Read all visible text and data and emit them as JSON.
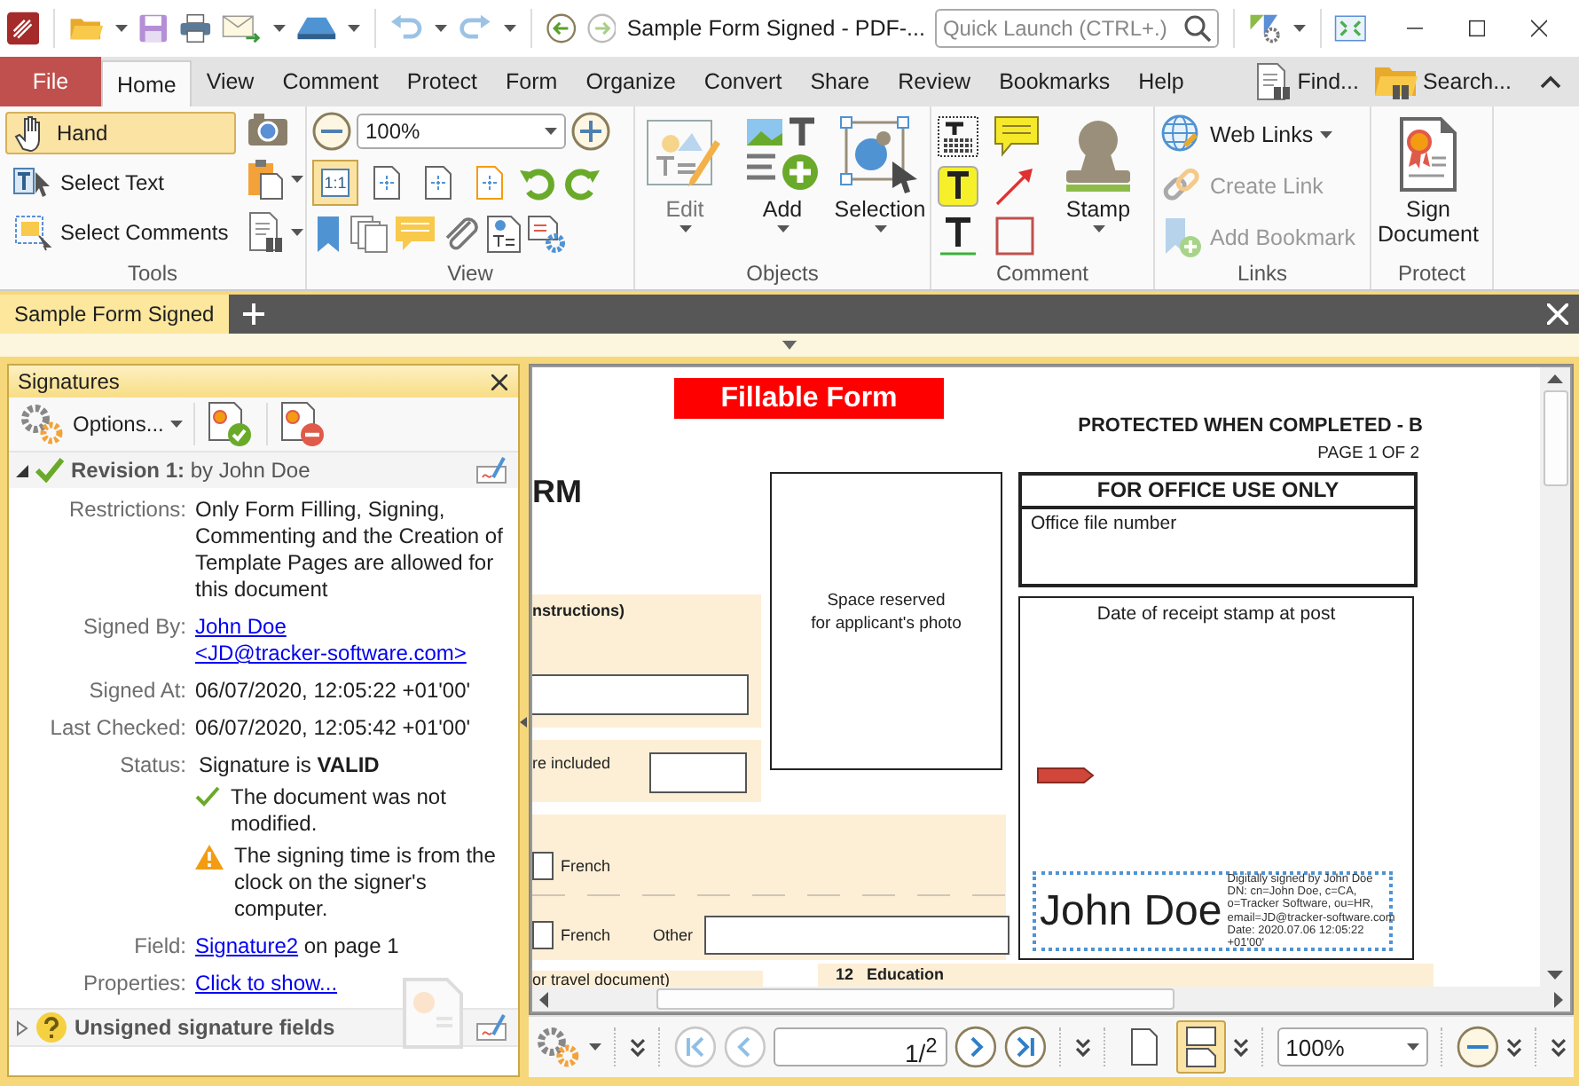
{
  "window": {
    "title": "Sample Form Signed - PDF-..."
  },
  "quick_launch": {
    "placeholder": "Quick Launch (CTRL+.)"
  },
  "ribbon": {
    "tabs": [
      {
        "label": "File",
        "kind": "file"
      },
      {
        "label": "Home",
        "kind": "tab",
        "selected": true
      },
      {
        "label": "View",
        "kind": "tab",
        "selected": false
      },
      {
        "label": "Comment",
        "kind": "tab",
        "selected": false
      },
      {
        "label": "Protect",
        "kind": "tab",
        "selected": false
      },
      {
        "label": "Form",
        "kind": "tab",
        "selected": false
      },
      {
        "label": "Organize",
        "kind": "tab",
        "selected": false
      },
      {
        "label": "Convert",
        "kind": "tab",
        "selected": false
      },
      {
        "label": "Share",
        "kind": "tab",
        "selected": false
      },
      {
        "label": "Review",
        "kind": "tab",
        "selected": false
      },
      {
        "label": "Bookmarks",
        "kind": "tab",
        "selected": false
      },
      {
        "label": "Help",
        "kind": "tab",
        "selected": false
      }
    ],
    "actions": [
      {
        "label": "Find..."
      },
      {
        "label": "Search..."
      }
    ],
    "groups": [
      {
        "kind": "tools",
        "title": "Tools",
        "items": [
          {
            "label": "Hand",
            "selected": true
          },
          {
            "label": "Select Text",
            "selected": false
          },
          {
            "label": "Select Comments",
            "selected": false
          }
        ]
      },
      {
        "kind": "view",
        "title": "View",
        "zoom": "100%",
        "fit_buttons": [
          {
            "label": "1:1",
            "selected": true
          },
          {
            "selected": false
          },
          {
            "selected": false
          },
          {
            "selected": false
          }
        ]
      },
      {
        "kind": "objects",
        "title": "Objects",
        "items": [
          {
            "label": "Edit",
            "disabled": true
          },
          {
            "label": "Add",
            "disabled": false
          },
          {
            "label": "Selection",
            "disabled": false
          }
        ]
      },
      {
        "kind": "comment",
        "title": "Comment",
        "items": [
          {
            "label": "Stamp"
          }
        ]
      },
      {
        "kind": "links",
        "title": "Links",
        "items": [
          {
            "label": "Web Links",
            "disabled": false
          },
          {
            "label": "Create Link",
            "disabled": true
          },
          {
            "label": "Add Bookmark",
            "disabled": true
          }
        ]
      },
      {
        "kind": "protect",
        "title": "Protect",
        "items": [
          {
            "label": "Sign Document"
          }
        ]
      }
    ]
  },
  "document_tabs": [
    {
      "label": "Sample Form Signed",
      "selected": true
    }
  ],
  "signatures_panel": {
    "title": "Signatures",
    "options_label": "Options...",
    "revision": {
      "title": "Revision 1:",
      "by": "by John Doe",
      "expanded": true,
      "details": [
        {
          "label": "Restrictions:",
          "kind": "text",
          "text": "Only Form Filling, Signing, Commenting and the Creation of Template Pages are allowed for this document"
        },
        {
          "label": "Signed By:",
          "kind": "link",
          "lines": [
            "John Doe",
            "<JD@tracker-software.com>"
          ]
        },
        {
          "label": "Signed At:",
          "kind": "text",
          "text": "06/07/2020, 12:05:22 +01'00'"
        },
        {
          "label": "Last Checked:",
          "kind": "text",
          "text": "06/07/2020, 12:05:42 +01'00'"
        },
        {
          "label": "Status:",
          "kind": "status",
          "text": "Signature is **VALID**",
          "notes": [
            {
              "kind": "ok",
              "text": "The document was not modified."
            },
            {
              "kind": "warning",
              "text": "The signing time is from the clock on the signer's computer."
            }
          ]
        },
        {
          "label": "Field:",
          "kind": "link_suffix",
          "link": "Signature2",
          "suffix": " on page 1"
        },
        {
          "label": "Properties:",
          "kind": "link",
          "lines": [
            "Click to show..."
          ]
        }
      ]
    },
    "unsigned": {
      "label": "Unsigned signature fields",
      "expanded": false
    }
  },
  "page": {
    "banner": "Fillable Form",
    "heading_fragment": "RM",
    "protected_note": "PROTECTED WHEN COMPLETED - B",
    "page_number": "PAGE 1 OF 2",
    "photo_box": [
      "Space reserved",
      "for applicant's photo"
    ],
    "office_box": {
      "title": "FOR OFFICE USE ONLY",
      "label": "Office file number"
    },
    "stamp_box": {
      "title": "Date of receipt stamp at post"
    },
    "section_texts": [
      "nstructions)",
      "re included",
      "or travel document)",
      "12   Education"
    ],
    "language_options": [
      {
        "label": "French",
        "checked": false
      },
      {
        "label": "French",
        "checked": false
      }
    ],
    "other_label": "Other",
    "signature": {
      "name": "John Doe",
      "details": [
        "Digitally signed by John Doe",
        "DN: cn=John Doe, c=CA,",
        "o=Tracker Software, ou=HR,",
        "email=JD@tracker-software.com",
        "Date: 2020.07.06 12:05:22",
        "+01'00'"
      ]
    }
  },
  "bottom_bar": {
    "nav": [
      {
        "kind": "first",
        "disabled": true
      },
      {
        "kind": "prev",
        "disabled": true
      },
      {
        "kind": "next",
        "disabled": false
      },
      {
        "kind": "last",
        "disabled": false
      }
    ],
    "page": "1/$^{2}$",
    "layouts": [
      {
        "kind": "single",
        "selected": false
      },
      {
        "kind": "double",
        "selected": true
      }
    ],
    "zoom": "100%"
  }
}
